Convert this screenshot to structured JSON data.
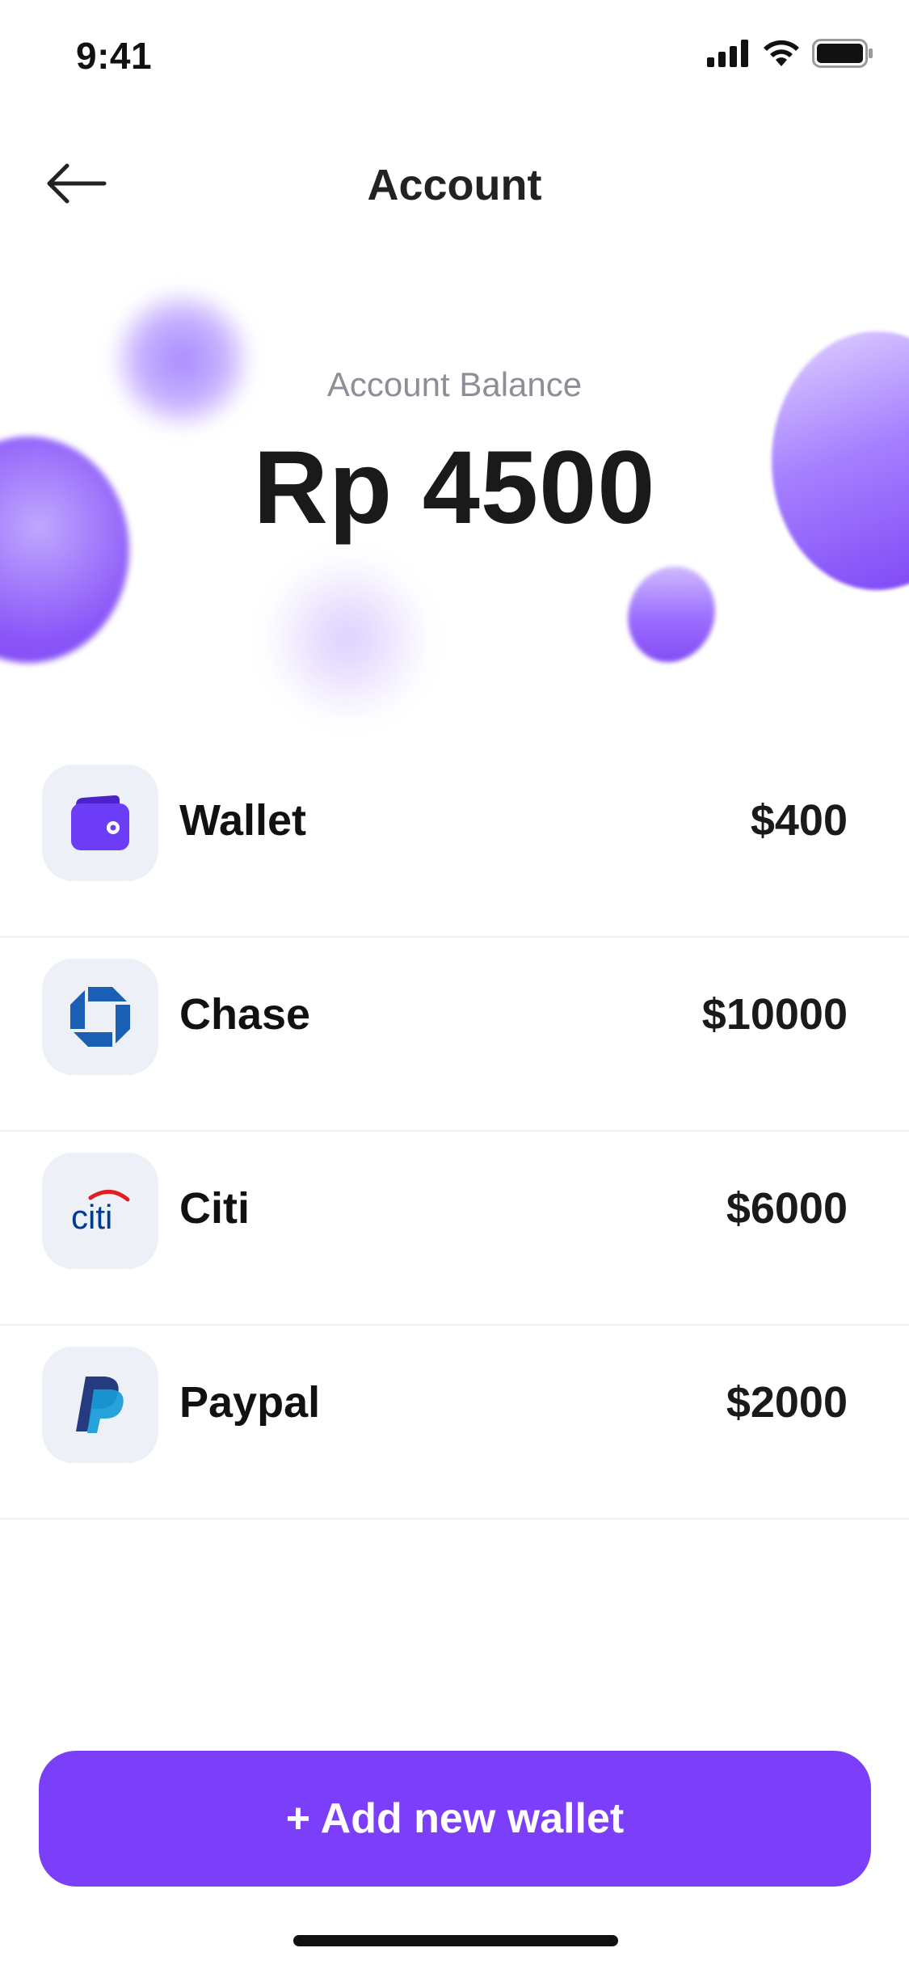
{
  "status_bar": {
    "time": "9:41",
    "icons": [
      "cellular-signal-icon",
      "wifi-icon",
      "battery-icon"
    ]
  },
  "nav": {
    "back_icon": "arrow-left-icon",
    "title": "Account"
  },
  "balance": {
    "label": "Account Balance",
    "amount": "Rp 4500"
  },
  "accounts": [
    {
      "name": "Wallet",
      "amount": "$400",
      "icon": "wallet-icon"
    },
    {
      "name": "Chase",
      "amount": "$10000",
      "icon": "chase-logo-icon"
    },
    {
      "name": "Citi",
      "amount": "$6000",
      "icon": "citi-logo-icon",
      "logo_text": "citi"
    },
    {
      "name": "Paypal",
      "amount": "$2000",
      "icon": "paypal-logo-icon"
    }
  ],
  "actions": {
    "add_wallet_label": "+ Add new wallet"
  },
  "colors": {
    "accent": "#7c3ff9",
    "wallet_icon": "#6c3cf6",
    "chase_blue": "#1a5fb4",
    "citi_blue": "#003b8e",
    "citi_red": "#e01e26",
    "paypal_dark": "#253b80",
    "paypal_light": "#179bd7"
  }
}
